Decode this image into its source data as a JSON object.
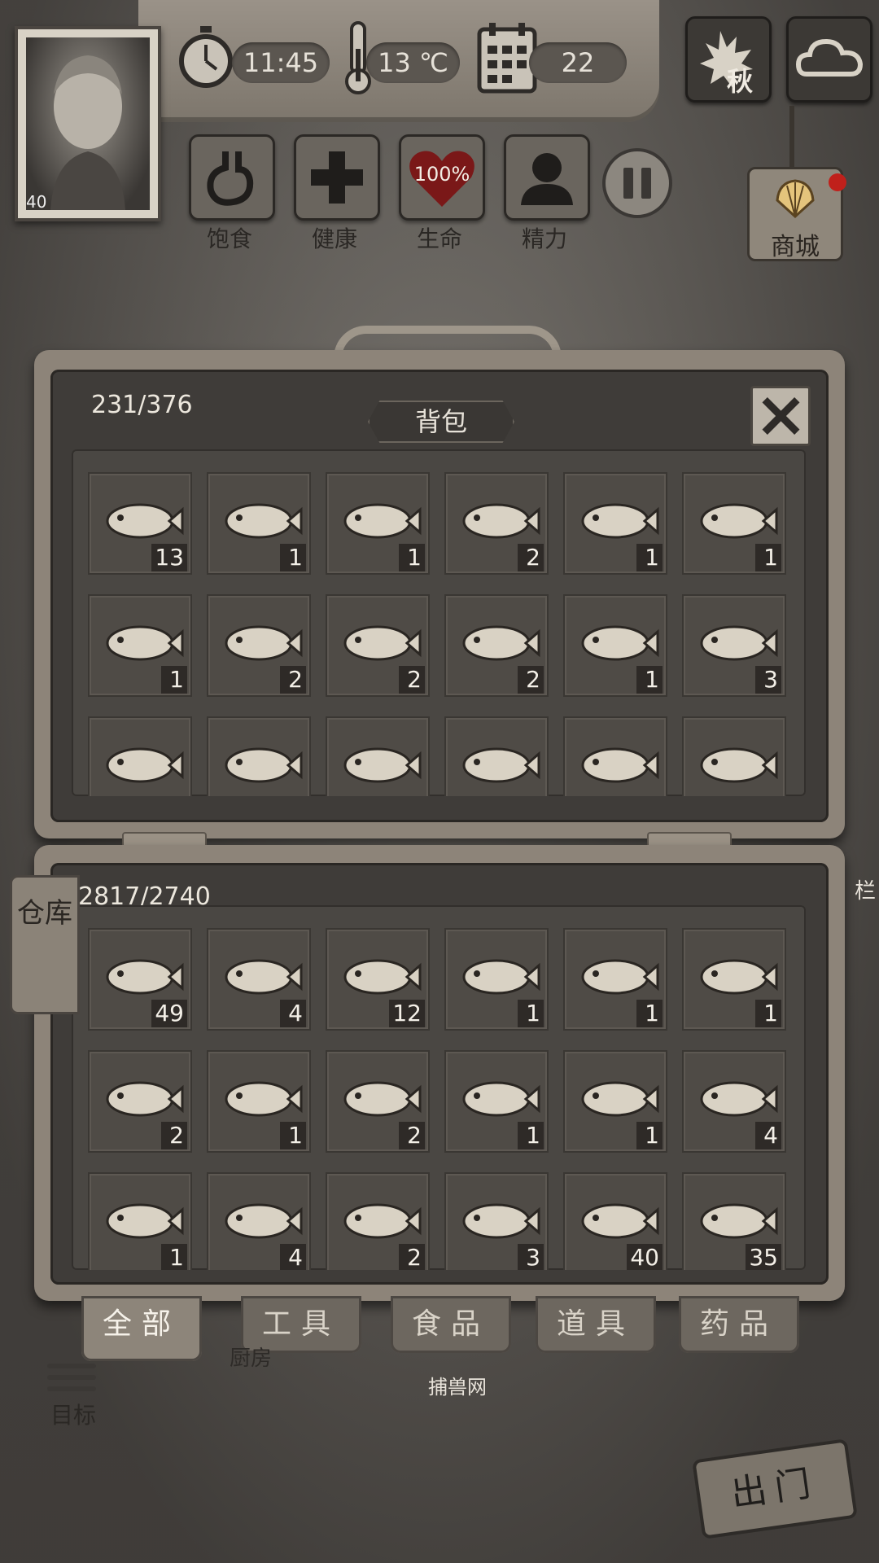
{
  "hud": {
    "time": "11:45",
    "temperature": "13 ℃",
    "day": "22",
    "season": "秋",
    "level": "40"
  },
  "stats": [
    {
      "label": "饱食",
      "icon": "stomach-icon"
    },
    {
      "label": "健康",
      "icon": "health-cross-icon"
    },
    {
      "label": "生命",
      "icon": "heart-icon",
      "value": "100%"
    },
    {
      "label": "精力",
      "icon": "energy-person-icon"
    }
  ],
  "shop": {
    "label": "商城",
    "icon": "shell-icon"
  },
  "backpack": {
    "title": "背包",
    "capacity": "231/376",
    "items": [
      {
        "icon": "cooked-meat-icon",
        "qty": "13"
      },
      {
        "icon": "jellyfish-icon",
        "qty": "1"
      },
      {
        "icon": "fish-icon",
        "qty": "1"
      },
      {
        "icon": "pomfret-icon",
        "qty": "2"
      },
      {
        "icon": "lionfish-icon",
        "qty": "1"
      },
      {
        "icon": "grouper-icon",
        "qty": "1"
      },
      {
        "icon": "pufferfish-icon",
        "qty": "1"
      },
      {
        "icon": "frogfish-icon",
        "qty": "2"
      },
      {
        "icon": "swordfish-icon",
        "qty": "2"
      },
      {
        "icon": "tuna-icon",
        "qty": "2"
      },
      {
        "icon": "lobster-icon",
        "qty": "1"
      },
      {
        "icon": "flatfish-icon",
        "qty": "3"
      },
      {
        "icon": "sardine-icon",
        "qty": ""
      },
      {
        "icon": "needlefish-icon",
        "qty": ""
      },
      {
        "icon": "grouper-head-icon",
        "qty": ""
      },
      {
        "icon": "angelfish-icon",
        "qty": ""
      },
      {
        "icon": "cod-icon",
        "qty": ""
      },
      {
        "icon": "rope-icon",
        "qty": ""
      }
    ]
  },
  "storage": {
    "tab_label": "仓库",
    "capacity": "2817/2740",
    "items": [
      {
        "icon": "cooked-meat-icon",
        "qty": "49"
      },
      {
        "icon": "potato-icon",
        "qty": "4"
      },
      {
        "icon": "fish-steak-icon",
        "qty": "12"
      },
      {
        "icon": "herring-icon",
        "qty": "1"
      },
      {
        "icon": "eel-icon",
        "qty": "1"
      },
      {
        "icon": "jellyfish-icon",
        "qty": "1"
      },
      {
        "icon": "fish-icon",
        "qty": "2"
      },
      {
        "icon": "pomfret-icon",
        "qty": "1"
      },
      {
        "icon": "snapper-icon",
        "qty": "2"
      },
      {
        "icon": "sea-cucumber-icon",
        "qty": "1"
      },
      {
        "icon": "lionfish-icon",
        "qty": "1"
      },
      {
        "icon": "grouper-icon",
        "qty": "4"
      },
      {
        "icon": "pufferfish-icon",
        "qty": "1"
      },
      {
        "icon": "frogfish-icon",
        "qty": "4"
      },
      {
        "icon": "swordfish-icon",
        "qty": "2"
      },
      {
        "icon": "tuna-icon",
        "qty": "3"
      },
      {
        "icon": "herb-branch-icon",
        "qty": "40"
      },
      {
        "icon": "rope-icon",
        "qty": "35"
      }
    ]
  },
  "tabs": [
    "全部",
    "工具",
    "食品",
    "道具",
    "药品"
  ],
  "map": {
    "kitchen": "厨房",
    "trap_net": "捕兽网",
    "fence": "栏",
    "goal": "目标",
    "exit": "出门"
  }
}
